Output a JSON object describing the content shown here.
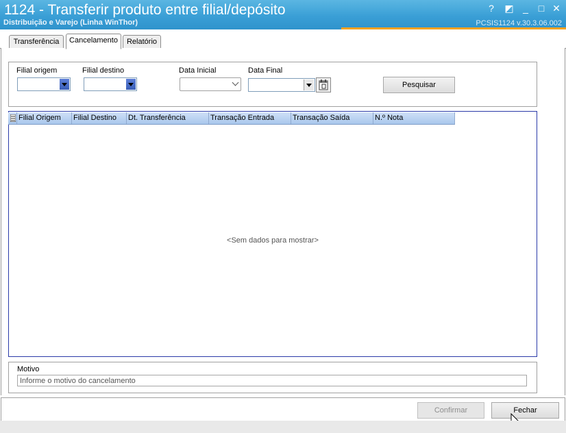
{
  "window": {
    "title": "1124 - Transferir produto entre filial/depósito",
    "subtitle": "Distribuição e Varejo (Linha WinThor)",
    "version": "PCSIS1124  v.30.3.06.002",
    "controls": [
      "?",
      "◩",
      "_",
      "□",
      "✕"
    ]
  },
  "tabs": [
    {
      "label": "Transferência",
      "active": false
    },
    {
      "label": "Cancelamento",
      "active": true
    },
    {
      "label": "Relatório",
      "active": false
    }
  ],
  "filters": {
    "filial_origem_label": "Filial origem",
    "filial_destino_label": "Filial destino",
    "data_inicial_label": "Data Inicial",
    "data_final_label": "Data Final",
    "pesquisar_label": "Pesquisar"
  },
  "grid": {
    "columns": [
      "Filial Origem",
      "Filial Destino",
      "Dt. Transferência",
      "Transação Entrada",
      "Transação Saída",
      "N.º Nota"
    ],
    "empty_text": "<Sem dados para mostrar>"
  },
  "motivo": {
    "label": "Motivo",
    "placeholder": "Informe o motivo do cancelamento"
  },
  "footer": {
    "confirmar_label": "Confirmar",
    "fechar_label": "Fechar"
  },
  "colors": {
    "titlebar": "#3a9fd6",
    "accent": "#f4a21e",
    "grid_border": "#2a3aa8"
  }
}
